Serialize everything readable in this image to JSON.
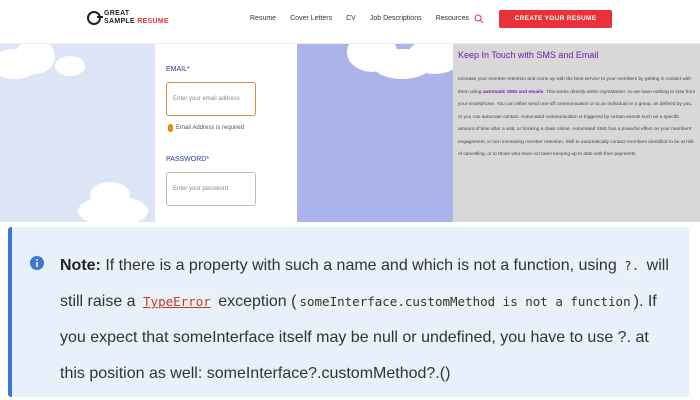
{
  "header": {
    "logo_line1": "GREAT",
    "logo_line2a": "SAMPLE ",
    "logo_line2b": "RESUME",
    "nav": [
      "Resume",
      "Cover Letters",
      "CV",
      "Job Descriptions",
      "Resources"
    ],
    "cta_label": "CREATE YOUR RESUME",
    "icon": "search-icon"
  },
  "form": {
    "email_label": "EMAIL*",
    "email_placeholder": "Enter your email address",
    "email_error": "Email Address is required",
    "password_label": "PASSWORD*",
    "password_placeholder": "Enter your password"
  },
  "article": {
    "title": "Keep In Touch with SMS and Email",
    "p_before": "Increase your member retention and come up with the best service to your members by getting in contact with them using ",
    "p_highlight": "automatic SMS and emails",
    "p_after": ". This works directly within GymMaster, so we have nothing to lose from your smartphone. You can either send one-off communication or to an individual or a group, as defined by you, or you can automate contact. Automated communication is triggered by certain events such as a specific amount of time after a visit, or booking a class online. Automated SMS has a powerful effect on your members' engagement, in turn increasing member retention. Skill to automatically contact members identified to be at risk of cancelling, or to those who have not been keeping up to date with their payments."
  },
  "note": {
    "label": "Note:",
    "t1": " If there is a property with such a name and which is not a function, using ",
    "c1": "?.",
    "t2": " will still raise a ",
    "c2": "TypeError",
    "t3": " exception (",
    "c3": "someInterface.customMethod is not a function",
    "t4": "). If you expect that someInterface itself may be null or undefined, you have to use ?. at this position as well: someInterface?.customMethod?.()",
    "icon": "info-icon"
  },
  "colors": {
    "brand_red": "#e8313a",
    "note_bg": "#e7f0fb",
    "note_border": "#3b78d6",
    "article_title": "#6b1fa6"
  }
}
